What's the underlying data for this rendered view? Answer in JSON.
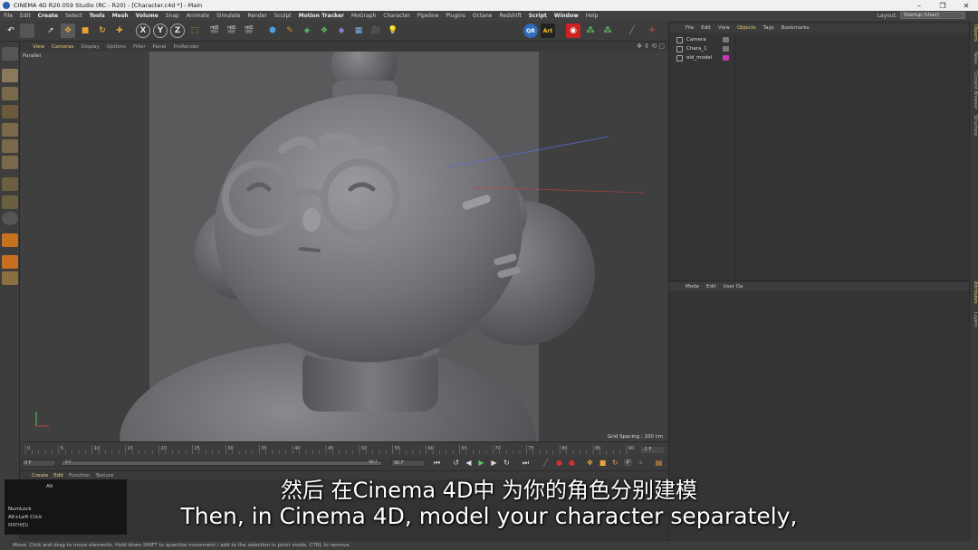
{
  "window": {
    "title": "CINEMA 4D R20.059 Studio (RC - R20) - [Character.c4d *] - Main",
    "buttons": [
      "–",
      "❐",
      "✕"
    ]
  },
  "menubar": {
    "items": [
      {
        "label": "File",
        "bold": false
      },
      {
        "label": "Edit",
        "bold": false
      },
      {
        "label": "Create",
        "bold": true
      },
      {
        "label": "Select",
        "bold": false
      },
      {
        "label": "Tools",
        "bold": true
      },
      {
        "label": "Mesh",
        "bold": true
      },
      {
        "label": "Volume",
        "bold": true
      },
      {
        "label": "Snap",
        "bold": false
      },
      {
        "label": "Animate",
        "bold": false
      },
      {
        "label": "Simulate",
        "bold": false
      },
      {
        "label": "Render",
        "bold": false
      },
      {
        "label": "Sculpt",
        "bold": false
      },
      {
        "label": "Motion Tracker",
        "bold": true
      },
      {
        "label": "MoGraph",
        "bold": false
      },
      {
        "label": "Character",
        "bold": false
      },
      {
        "label": "Pipeline",
        "bold": false
      },
      {
        "label": "Plugins",
        "bold": false
      },
      {
        "label": "Octane",
        "bold": false
      },
      {
        "label": "Redshift",
        "bold": false
      },
      {
        "label": "Script",
        "bold": true
      },
      {
        "label": "Window",
        "bold": true
      },
      {
        "label": "Help",
        "bold": false
      }
    ],
    "layout_label": "Layout:",
    "layout_value": "Startup (User)"
  },
  "toolbar": {
    "axis_x": "X",
    "axis_y": "Y",
    "axis_z": "Z",
    "qr_label": "QR",
    "art_label": "Art"
  },
  "viewport": {
    "menu": [
      {
        "label": "View",
        "hi": true
      },
      {
        "label": "Cameras",
        "hi": true
      },
      {
        "label": "Display",
        "hi": false
      },
      {
        "label": "Options",
        "hi": false
      },
      {
        "label": "Filter",
        "hi": false
      },
      {
        "label": "Panel",
        "hi": false
      },
      {
        "label": "ProRender",
        "hi": false
      }
    ],
    "projection": "Parallel",
    "grid_spacing": "Grid Spacing : 100 cm"
  },
  "timeline": {
    "ticks": [
      "0",
      "5",
      "10",
      "15",
      "20",
      "25",
      "30",
      "35",
      "40",
      "45",
      "50",
      "55",
      "60",
      "65",
      "70",
      "75",
      "80",
      "85",
      "90"
    ],
    "frame_right": "-1 F"
  },
  "transport": {
    "start_field": "0 F",
    "slider_start": "0 F",
    "slider_end": "90 F",
    "end_field": "90 F"
  },
  "material": {
    "menu": [
      {
        "label": "Create",
        "hi": true
      },
      {
        "label": "Edit",
        "hi": true
      },
      {
        "label": "Function",
        "hi": false
      },
      {
        "label": "Texture",
        "hi": false
      }
    ]
  },
  "key_overlay": {
    "key": "Alt",
    "line1": "NumLock",
    "line2": "Alt+Left Click",
    "line3": "MATHIEU"
  },
  "status": "Move: Click and drag to move elements. Hold down SHIFT to quantize movement / add to the selection in point mode, CTRL to remove.",
  "objects_panel": {
    "menu": [
      {
        "label": "File",
        "hi": false
      },
      {
        "label": "Edit",
        "hi": false
      },
      {
        "label": "View",
        "hi": false
      },
      {
        "label": "Objects",
        "hi": true
      },
      {
        "label": "Tags",
        "hi": false
      },
      {
        "label": "Bookmarks",
        "hi": false
      }
    ],
    "objects": [
      {
        "name": "Camera",
        "tag_color": "#7a7a7a"
      },
      {
        "name": "Chara_1",
        "tag_color": "#7a7a7a"
      },
      {
        "name": "old_model",
        "tag_color": "#c43ab0"
      }
    ]
  },
  "attributes_panel": {
    "menu": [
      "Mode",
      "Edit",
      "User Da"
    ]
  },
  "right_tabs": [
    {
      "label": "Objects",
      "hi": true
    },
    {
      "label": "Takes",
      "hi": false
    },
    {
      "label": "Content Browser",
      "hi": false
    },
    {
      "label": "Structure",
      "hi": false
    },
    {
      "label": "Attributes",
      "hi": true
    },
    {
      "label": "Layers",
      "hi": false
    }
  ],
  "subtitles": {
    "cn": "然后 在Cinema 4D中 为你的角色分别建模",
    "en": "Then, in Cinema 4D, model your character separately,"
  }
}
